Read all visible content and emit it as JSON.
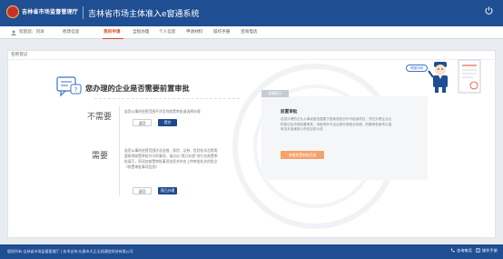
{
  "header": {
    "logo_text": "吉林省市场监督管理厅",
    "system_title": "吉林省市场主体准入e窗通系统",
    "power_icon": "power-icon"
  },
  "nav": {
    "welcome": "欢迎您：刘洋",
    "items": [
      {
        "label": "修改信息"
      },
      {
        "label": "我的申请"
      },
      {
        "label": "全程办理"
      },
      {
        "label": "个人信息"
      },
      {
        "label": "申请材料"
      },
      {
        "label": "操作手册"
      },
      {
        "label": "咨询电话"
      }
    ],
    "active_index": 1
  },
  "breadcrumb": "名称登记",
  "question": {
    "title": "您办理的企业是否需要前置审批"
  },
  "options": {
    "no": {
      "label": "不需要",
      "text": "若您从事的经营范围不涉及到前置审批请选择办理",
      "back_label": "返回",
      "submit_label": "提交"
    },
    "yes": {
      "label": "需要",
      "text": "若您从事的经营范围涉及金融、保险、证券、危险化学品等需要取得前置审批许可的事项，请点击“我已办理”进行在前置审批填写，再添加前置审批事项信息并补充上传审批机关的批文《前置审批事项信息》",
      "back_label": "返回",
      "submit_label": "我已办理"
    }
  },
  "notice": {
    "tag": "温馨提示",
    "title": "前置审批",
    "text": "若您办理的企业从事经营范围属于国家规定的许可经营项目，须在办理企业名称登记后申请前置审批，待取得许可证后再申请营业执照。前置审批事项以国家及本省最新公布的目录为准",
    "button_label": "查看前置审批目录",
    "bubble": "有疑问吗"
  },
  "footer": {
    "text": "版权所有:吉林省市场监督管理厅 | 技术支持:长春市大正无线通信科技有限公司",
    "links": [
      {
        "label": "咨询电话",
        "icon": "phone-icon"
      },
      {
        "label": "操作手册",
        "icon": "book-icon"
      }
    ]
  },
  "colors": {
    "brand": "#1f4e92",
    "active": "#e2492a",
    "primary_button": "#1d4a8c",
    "accent_button": "#f5a26a"
  }
}
